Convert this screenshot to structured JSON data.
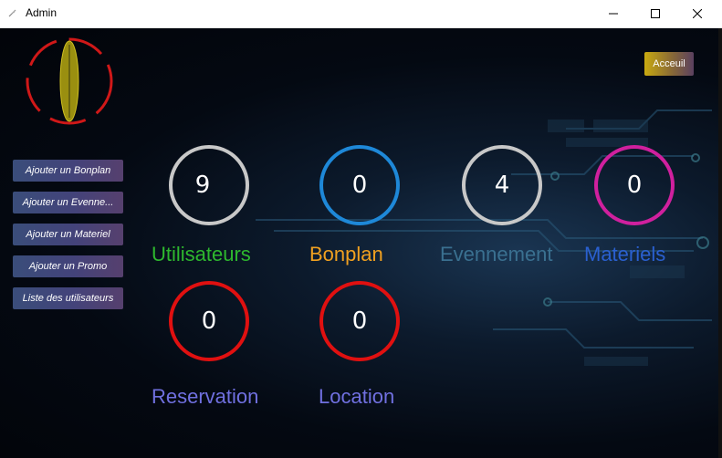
{
  "window": {
    "title": "Admin"
  },
  "header": {
    "home_button": "Acceuil"
  },
  "sidebar": {
    "buttons": [
      {
        "label": "Ajouter un  Bonplan"
      },
      {
        "label": "Ajouter un Evenne..."
      },
      {
        "label": "Ajouter un Materiel"
      },
      {
        "label": "Ajouter un Promo"
      },
      {
        "label": "Liste des utilisateurs"
      }
    ]
  },
  "stats": [
    {
      "value": "9",
      "label": "Utilisateurs",
      "ring_color": "#c8c8c8",
      "label_color": "#2eb82e"
    },
    {
      "value": "0",
      "label": "Bonplan",
      "ring_color": "#1e88d8",
      "label_color": "#f0a020"
    },
    {
      "value": "4",
      "label": "Evennement",
      "ring_color": "#c8c8c8",
      "label_color": "#3a7090"
    },
    {
      "value": "0",
      "label": "Materiels",
      "ring_color": "#d0209e",
      "label_color": "#2a60d0"
    },
    {
      "value": "0",
      "label": "Reservation",
      "ring_color": "#e01010",
      "label_color": "#7070e0"
    },
    {
      "value": "0",
      "label": "Location",
      "ring_color": "#e01010",
      "label_color": "#7070e0"
    }
  ],
  "icons": {
    "app": "feather-icon",
    "minimize": "minimize-icon",
    "maximize": "maximize-icon",
    "close": "close-icon",
    "logo": "logo-icon"
  }
}
